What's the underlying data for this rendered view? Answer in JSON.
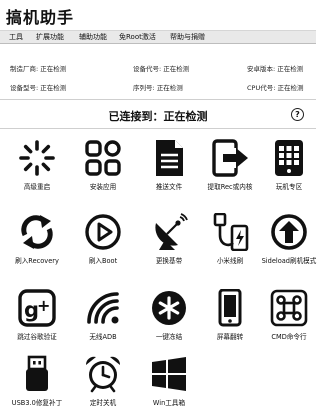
{
  "app": {
    "title": "搞机助手"
  },
  "menu": [
    "工具",
    "扩展功能",
    "辅助功能",
    "免Root激活",
    "帮助与捐赠"
  ],
  "info": {
    "manufacturer": "制造厂商: 正在检测",
    "device_code": "设备代号: 正在检测",
    "android_version": "安卓版本: 正在检测",
    "device_model": "设备型号: 正在检测",
    "serial": "序列号: 正在检测",
    "cpu_code": "CPU代号: 正在检测"
  },
  "status": {
    "text": "已连接到：正在检测",
    "help": "?"
  },
  "tools": [
    {
      "label": "高级重启",
      "icon": "spinner-icon"
    },
    {
      "label": "安装应用",
      "icon": "apps-grid-icon"
    },
    {
      "label": "推送文件",
      "icon": "document-icon"
    },
    {
      "label": "提取Rec或内核",
      "icon": "phone-export-icon"
    },
    {
      "label": "玩机专区",
      "icon": "phone-grid-icon"
    },
    {
      "label": "刷入Recovery",
      "icon": "refresh-arrows-icon"
    },
    {
      "label": "刷入Boot",
      "icon": "play-circle-icon"
    },
    {
      "label": "更换基带",
      "icon": "satellite-dish-icon"
    },
    {
      "label": "小米线刷",
      "icon": "usb-cable-icon"
    },
    {
      "label": "Sideload刷机模式",
      "icon": "upload-circle-icon"
    },
    {
      "label": "跳过谷歌验证",
      "icon": "google-plus-icon"
    },
    {
      "label": "无线ADB",
      "icon": "wifi-icon"
    },
    {
      "label": "一键冻结",
      "icon": "snowflake-icon"
    },
    {
      "label": "屏幕翻转",
      "icon": "phone-rotate-icon"
    },
    {
      "label": "CMD命令行",
      "icon": "command-key-icon"
    },
    {
      "label": "USB3.0修复补丁",
      "icon": "usb-drive-icon"
    },
    {
      "label": "定时关机",
      "icon": "alarm-clock-icon"
    },
    {
      "label": "Win工具箱",
      "icon": "windows-logo-icon"
    }
  ]
}
